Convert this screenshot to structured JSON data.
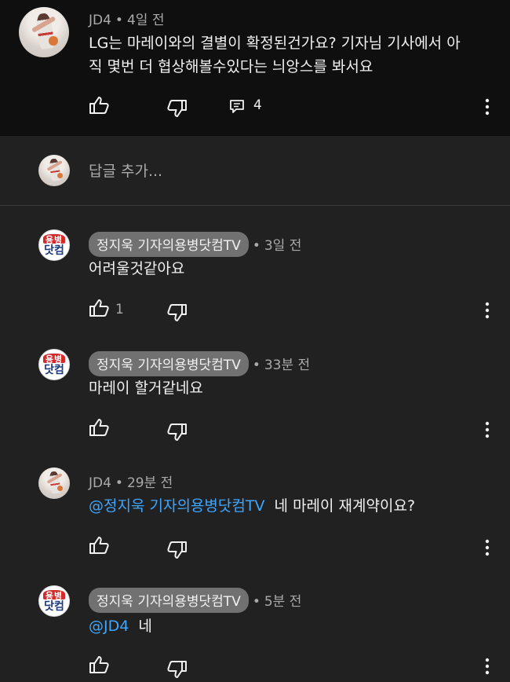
{
  "parent": {
    "author": "JD4",
    "time": "4일 전",
    "text_line1": "LG는 마레이와의 결별이 확정된건가요? 기자님 기사에서 아",
    "text_line2": "직 몇번 더 협상해볼수있다는 늬앙스를 봐서요",
    "reply_count": "4"
  },
  "reply_input": {
    "placeholder": "답글 추가..."
  },
  "channel_logo": {
    "top": "용병",
    "bottom": "닷컴"
  },
  "replies": [
    {
      "author": "정지욱 기자의용병닷컴TV",
      "time": "3일 전",
      "mention": "",
      "text": "어려울것같아요",
      "likes": "1"
    },
    {
      "author": "정지욱 기자의용병닷컴TV",
      "time": "33분 전",
      "mention": "",
      "text": "마레이 할거같네요",
      "likes": ""
    },
    {
      "author": "JD4",
      "time": "29분 전",
      "mention": "@정지욱 기자의용병닷컴TV",
      "text": "네 마레이 재계약이요?",
      "likes": ""
    },
    {
      "author": "정지욱 기자의용병닷컴TV",
      "time": "5분 전",
      "mention": "@JD4",
      "text": "네",
      "likes": ""
    }
  ],
  "separator": "•"
}
